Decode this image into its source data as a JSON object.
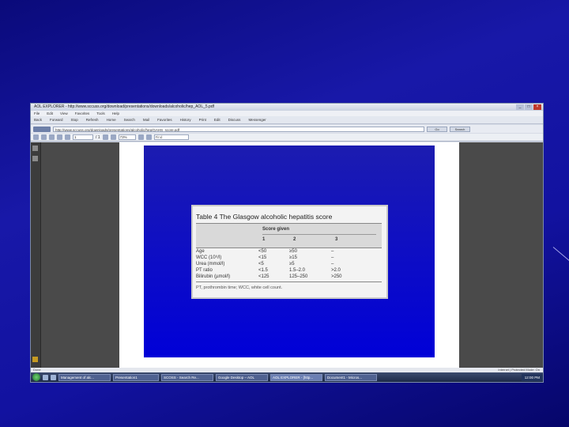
{
  "window": {
    "title": "AOL EXPLORER - http://www.sccuss.org/download/presentations/downloads/alcoholic/hep_AOL_5.pdf",
    "controls": [
      "_",
      "□",
      "×"
    ]
  },
  "menu": [
    "File",
    "Edit",
    "View",
    "Favorites",
    "Tools",
    "Help"
  ],
  "toolbar": [
    "Back",
    "Forward",
    "Stop",
    "Refresh",
    "Home",
    "Search",
    "Mail",
    "Favorites",
    "History",
    "Print",
    "Edit",
    "Discuss",
    "Messenger"
  ],
  "address": {
    "url": "http://www.sccuss.org/downloads/presentations/alcoholic/hep/GAHS_score.pdf",
    "go_label": "Go",
    "search_label": "Search"
  },
  "pdf_toolbar": {
    "page_value": "1",
    "page_total": "/ 1",
    "zoom_value": "73%",
    "find_placeholder": "Find"
  },
  "slide_table": {
    "title": "Table 4   The Glasgow alcoholic hepatitis score",
    "score_given": "Score given",
    "columns": [
      "1",
      "2",
      "3"
    ],
    "rows": [
      [
        "Age",
        "<50",
        "≥50",
        "–"
      ],
      [
        "WCC (10⁹/l)",
        "<15",
        "≥15",
        "–"
      ],
      [
        "Urea (mmol/l)",
        "<5",
        "≥5",
        "–"
      ],
      [
        "PT ratio",
        "<1.5",
        "1.5–2.0",
        ">2.0"
      ],
      [
        "Bilirubin (µmol/l)",
        "<125",
        "125–250",
        ">250"
      ]
    ],
    "footnote": "PT, prothrombin time; WCC, white cell count."
  },
  "statusbar": {
    "left": "Done",
    "right": "Internet | Protected Mode: On"
  },
  "taskbar": {
    "tasks": [
      "Management of alc...",
      "Presentation1",
      "SCOSS - Search Re...",
      "Google Desktop – AOL",
      "AOL EXPLORER - [http...",
      "Document1 - Micros..."
    ],
    "active_index": 4,
    "tray_text": "12:00 PM"
  },
  "colors": {
    "background": "#1212a0",
    "slide_blue": "#0000d8",
    "table_header": "#d9d9d9"
  }
}
